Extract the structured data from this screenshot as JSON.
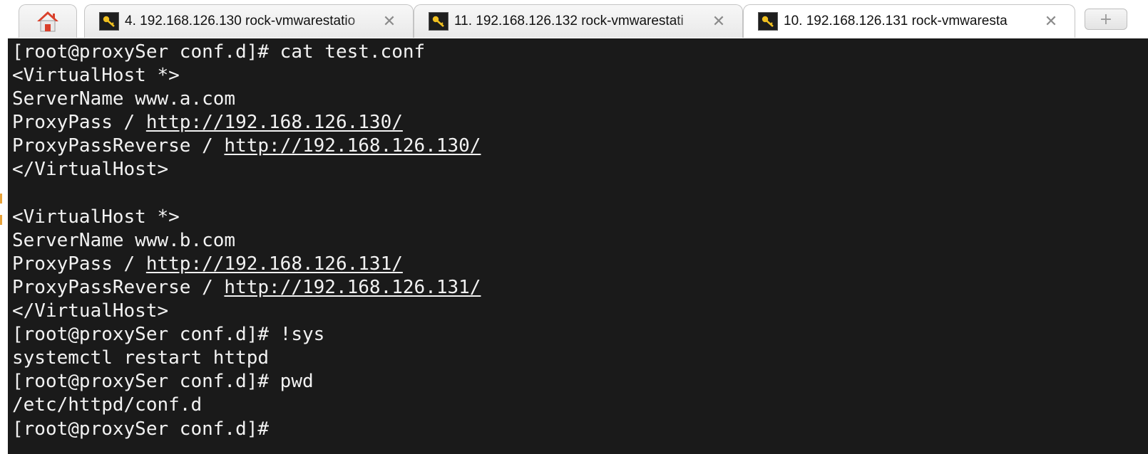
{
  "tabs": [
    {
      "title": "4. 192.168.126.130 rock-vmwarestatio",
      "close": "✕",
      "active": false
    },
    {
      "title": "11. 192.168.126.132 rock-vmwarestati",
      "close": "✕",
      "active": false
    },
    {
      "title": "10. 192.168.126.131 rock-vmwaresta",
      "close": "✕",
      "active": true
    }
  ],
  "new_tab": "+",
  "terminal": {
    "lines": [
      {
        "text": "[root@proxySer conf.d]# cat test.conf"
      },
      {
        "text": "<VirtualHost *>"
      },
      {
        "text": "ServerName www.a.com"
      },
      {
        "text": "ProxyPass / ",
        "url": "http://192.168.126.130/"
      },
      {
        "text": "ProxyPassReverse / ",
        "url": "http://192.168.126.130/"
      },
      {
        "text": "</VirtualHost>"
      },
      {
        "text": ""
      },
      {
        "text": "<VirtualHost *>"
      },
      {
        "text": "ServerName www.b.com"
      },
      {
        "text": "ProxyPass / ",
        "url": "http://192.168.126.131/"
      },
      {
        "text": "ProxyPassReverse / ",
        "url": "http://192.168.126.131/"
      },
      {
        "text": "</VirtualHost>"
      },
      {
        "text": "[root@proxySer conf.d]# !sys"
      },
      {
        "text": "systemctl restart httpd"
      },
      {
        "text": "[root@proxySer conf.d]# pwd"
      },
      {
        "text": "/etc/httpd/conf.d"
      },
      {
        "text": "[root@proxySer conf.d]#"
      }
    ],
    "colors": {
      "background": "#1a1a1a",
      "foreground": "#f2f2f2"
    }
  },
  "icons": {
    "home": "home-icon",
    "key": "key-icon",
    "close": "close-icon",
    "new_tab": "plus-icon"
  }
}
